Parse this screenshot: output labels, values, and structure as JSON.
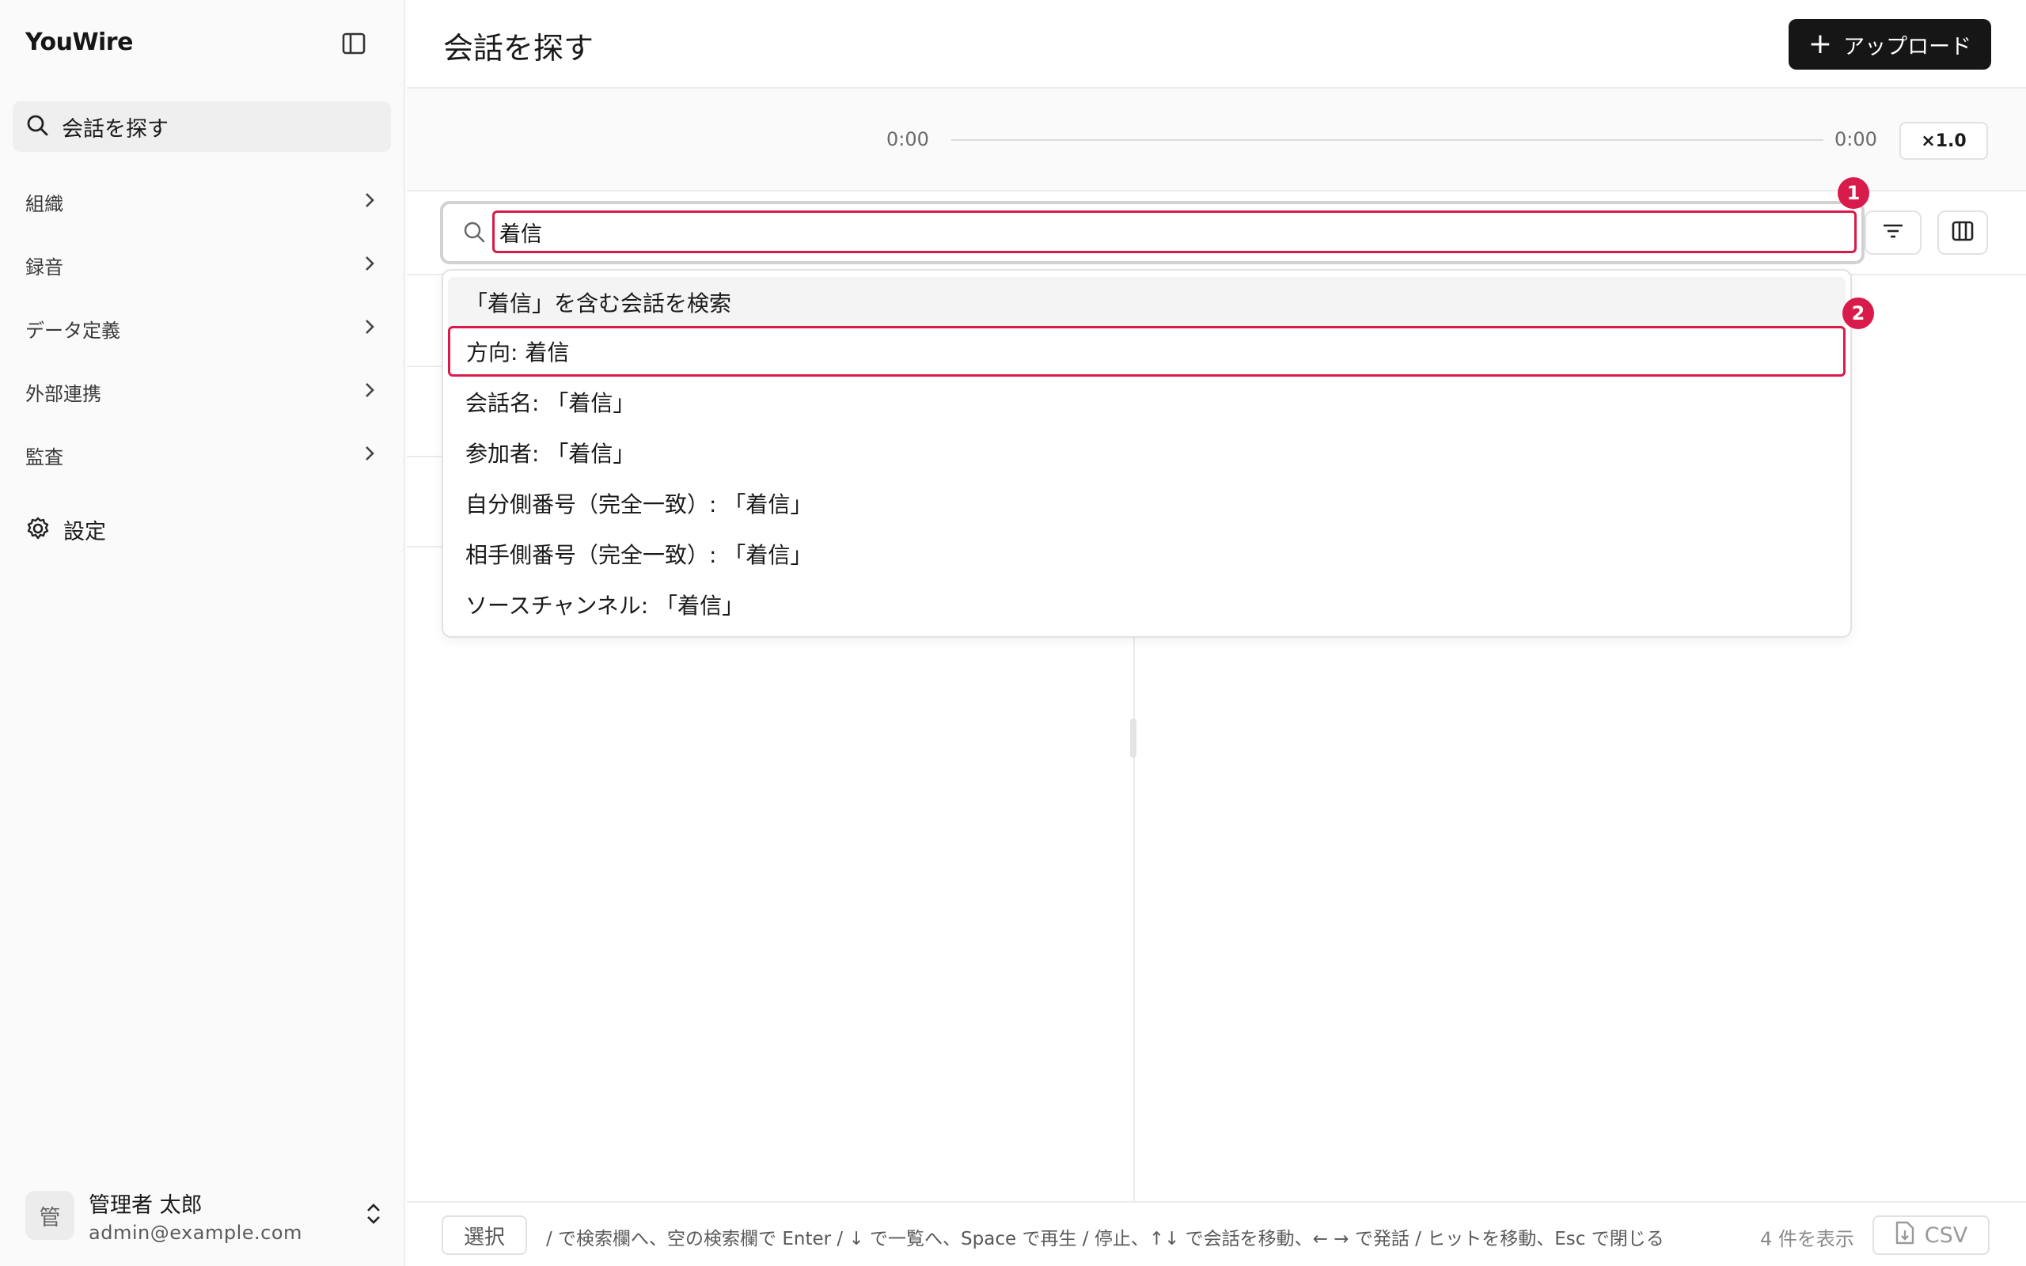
{
  "sidebar": {
    "brand": "YouWire",
    "active_item": {
      "label": "会話を探す",
      "icon": "search-icon"
    },
    "items": [
      {
        "label": "組織"
      },
      {
        "label": "録音"
      },
      {
        "label": "データ定義"
      },
      {
        "label": "外部連携"
      },
      {
        "label": "監査"
      }
    ],
    "settings_label": "設定",
    "user": {
      "avatar_text": "管",
      "name": "管理者 太郎",
      "email": "admin@example.com"
    }
  },
  "header": {
    "title": "会話を探す",
    "upload_label": "アップロード"
  },
  "player": {
    "time_start": "0:00",
    "time_end": "0:00",
    "speed": "×1.0",
    "progress": 0
  },
  "search": {
    "value": "着信"
  },
  "annotations": {
    "badge1": "1",
    "badge2": "2"
  },
  "dropdown": {
    "items": [
      "「着信」を含む会話を検索",
      "方向: 着信",
      "会話名: 「着信」",
      "参加者: 「着信」",
      "自分側番号（完全一致）: 「着信」",
      "相手側番号（完全一致）: 「着信」",
      "ソースチャンネル: 「着信」"
    ]
  },
  "footer": {
    "select_label": "選択",
    "hint": "/ で検索欄へ、空の検索欄で Enter / ↓ で一覧へ、Space で再生 / 停止、↑↓ で会話を移動、← → で発話 / ヒットを移動、Esc で閉じる",
    "count": "4 件を表示",
    "csv_label": "CSV"
  },
  "colors": {
    "accent": "#d81b4a",
    "button_dark": "#161616",
    "sidebar_bg": "#fafafa"
  }
}
